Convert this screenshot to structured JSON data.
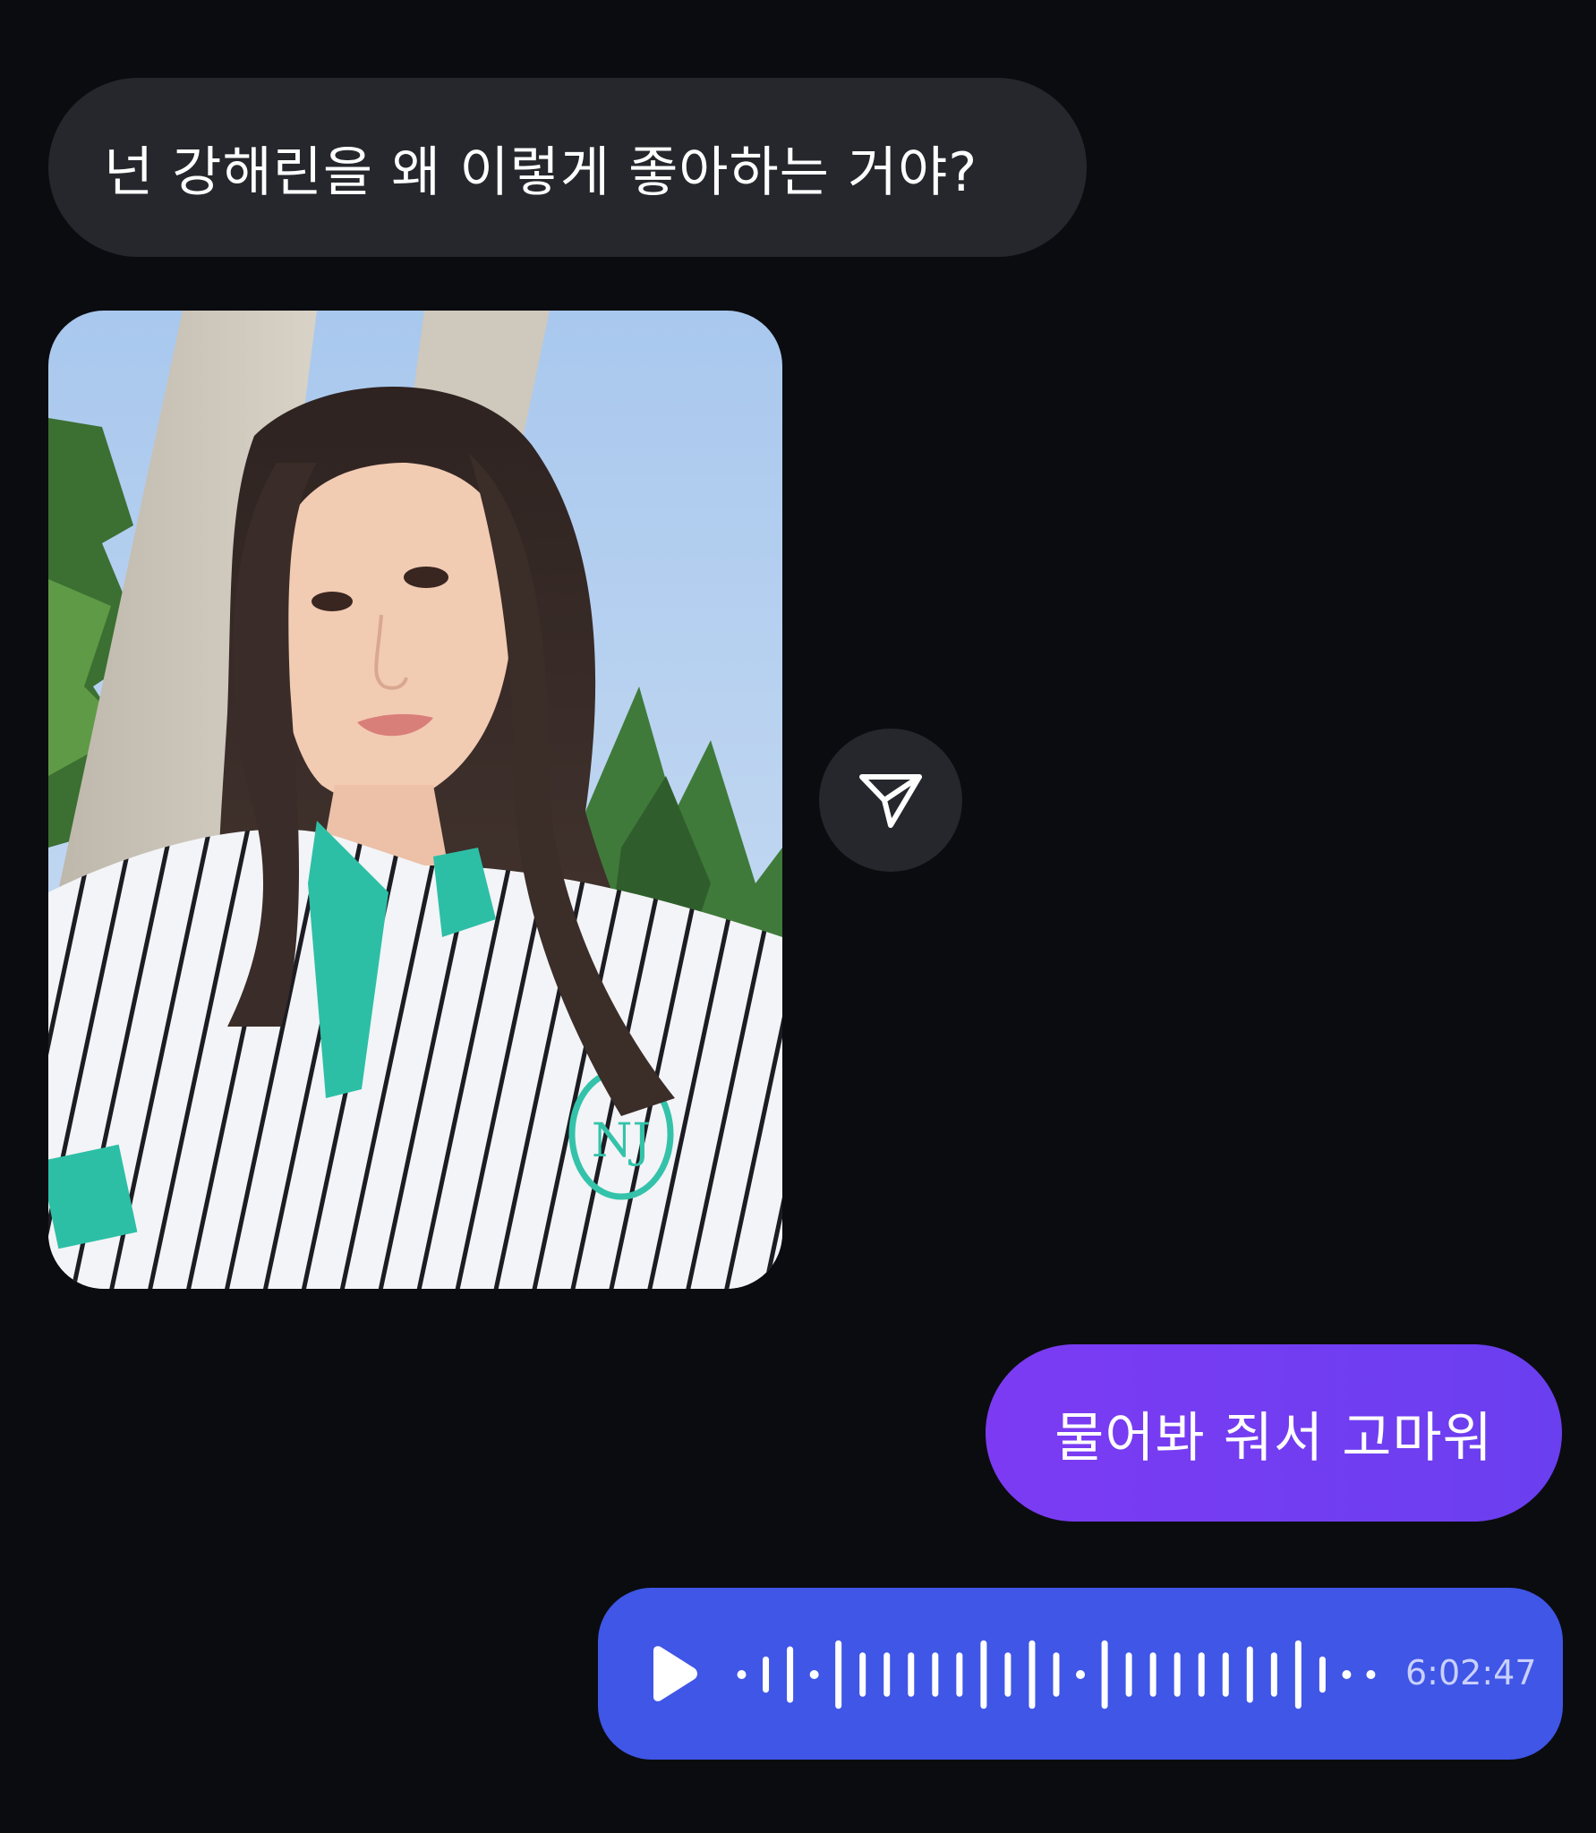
{
  "messages": {
    "incoming_text": "넌 강해린을 왜 이렇게 좋아하는 거야?",
    "outgoing_text": "물어봐 줘서 고마워"
  },
  "photo": {
    "shirt_emblem_text": "NJ"
  },
  "share": {
    "icon": "send-icon"
  },
  "voice_message": {
    "play_icon": "play-icon",
    "duration": "6:02:47",
    "waveform_levels": [
      0.1,
      0.45,
      0.7,
      0.12,
      0.85,
      0.55,
      0.55,
      0.55,
      0.55,
      0.55,
      0.85,
      0.55,
      0.85,
      0.55,
      0.12,
      0.85,
      0.55,
      0.55,
      0.55,
      0.55,
      0.55,
      0.7,
      0.55,
      0.85,
      0.45,
      0.12,
      0.1
    ]
  },
  "colors": {
    "background": "#0b0c10",
    "incoming_bubble": "#25272c",
    "outgoing_bubble": "#7c3bf2",
    "voice_bubble": "#3f56e6"
  }
}
